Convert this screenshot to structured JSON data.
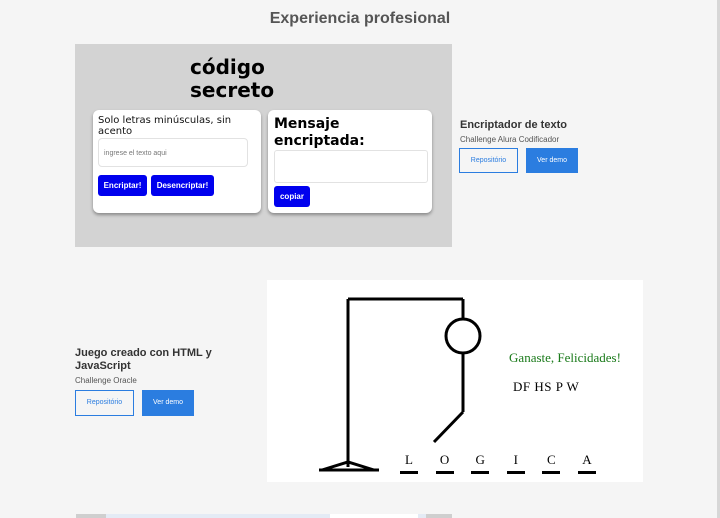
{
  "section_title": "Experiencia profesional",
  "project1": {
    "name": "Encriptador de texto",
    "subtitle": "Challenge Alura Codificador",
    "repo_label": "Repositório",
    "demo_label": "Ver demo",
    "screenshot": {
      "title": "código secreto",
      "instruction": "Solo letras minúsculas, sin acento",
      "input_placeholder": "ingrese el texto aqui",
      "encrypt_label": "Encriptar!",
      "decrypt_label": "Desencriptar!",
      "output_title": "Mensaje encriptada:",
      "copy_label": "copiar"
    }
  },
  "project2": {
    "name": "Juego creado con HTML y JavaScript",
    "subtitle": "Challenge Oracle",
    "repo_label": "Repositório",
    "demo_label": "Ver demo",
    "screenshot": {
      "win_message": "Ganaste, Felicidades!",
      "wrong_letters": "DF HS P W",
      "word": [
        "L",
        "O",
        "G",
        "I",
        "C",
        "A"
      ]
    }
  },
  "colors": {
    "accent": "#2b7de0",
    "screenshot_button": "#0000ee",
    "win_text": "#1a7a1a"
  }
}
